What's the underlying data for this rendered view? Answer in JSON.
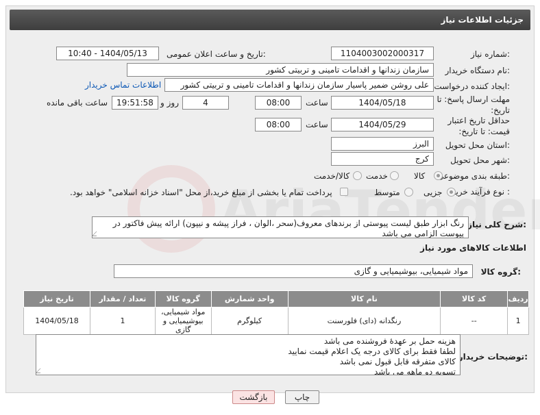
{
  "header": {
    "title": "جزئیات اطلاعات نیاز"
  },
  "fields": {
    "need_number_label": "شماره نیاز:",
    "need_number": "1104003002000317",
    "announce_label": "تاریخ و ساعت اعلان عمومی:",
    "announce_value": "1404/05/13 - 10:40",
    "buyer_org_label": "نام دستگاه خریدار:",
    "buyer_org": "سازمان زندانها و اقدامات تامینی و تربیتی کشور",
    "requester_label": "ایجاد کننده درخواست:",
    "requester": "علی روشن ضمیر پاسیار سازمان زندانها و اقدامات تامینی و تربیتی کشور",
    "buyer_contact_link": "اطلاعات تماس خریدار",
    "deadline_label": "مهلت ارسال پاسخ: تا تاریخ:",
    "deadline_date": "1404/05/18",
    "hour_label": "ساعت",
    "deadline_time": "08:00",
    "days_count": "4",
    "days_label": "روز و",
    "remaining_time": "19:51:58",
    "remaining_label": "ساعت باقی مانده",
    "price_validity_label": "حداقل تاریخ اعتبار قیمت: تا تاریخ:",
    "price_validity_date": "1404/05/29",
    "price_validity_time": "08:00",
    "province_label": "استان محل تحویل:",
    "province": "البرز",
    "city_label": "شهر محل تحویل:",
    "city": "کرج",
    "category_label": "طبقه بندی موضوعی:",
    "category_options": [
      "کالا",
      "خدمت",
      "کالا/خدمت"
    ],
    "process_label": "نوع فرآیند خرید :",
    "process_options": [
      "جزیی",
      "متوسط"
    ],
    "payment_note": "پرداخت تمام یا بخشی از مبلغ خرید،از محل \"اسناد خزانه اسلامی\" خواهد بود."
  },
  "description": {
    "label": "شرح کلی نیاز:",
    "text": "رنگ ابزار طبق لیست پیوستی از برندهای معروف(سحر ،الوان ، فراز پیشه و نیپون) ارائه پیش فاکتور در پیوست الزامی می باشد"
  },
  "goods_info_title": "اطلاعات کالاهای مورد نیاز",
  "goods_group": {
    "label": "گروه کالا:",
    "value": "مواد شیمیایی، بیوشیمیایی و  گازی"
  },
  "table": {
    "headers": [
      "ردیف",
      "کد کالا",
      "نام کالا",
      "واحد شمارش",
      "گروه کالا",
      "تعداد / مقدار",
      "تاریخ نیاز"
    ],
    "rows": [
      [
        "1",
        "--",
        "رنگدانه (دای) فلورسنت",
        "کیلوگرم",
        "مواد شیمیایی، بیوشیمیایی و گازی",
        "1",
        "1404/05/18"
      ]
    ]
  },
  "buyer_notes": {
    "label": "توضیحات خریدار:",
    "lines": [
      "هزینه حمل بر عهدۀ فروشنده می باشد",
      "لطفا فقط برای کالای درجه یک اعلام قیمت نمایید",
      "کالای متفرقه قابل قبول نمی باشد",
      "تسویه دو ماهه می باشد"
    ]
  },
  "buttons": {
    "print": "چاپ",
    "back": "بازگشت"
  },
  "watermark_text": "AriaTender.neT"
}
